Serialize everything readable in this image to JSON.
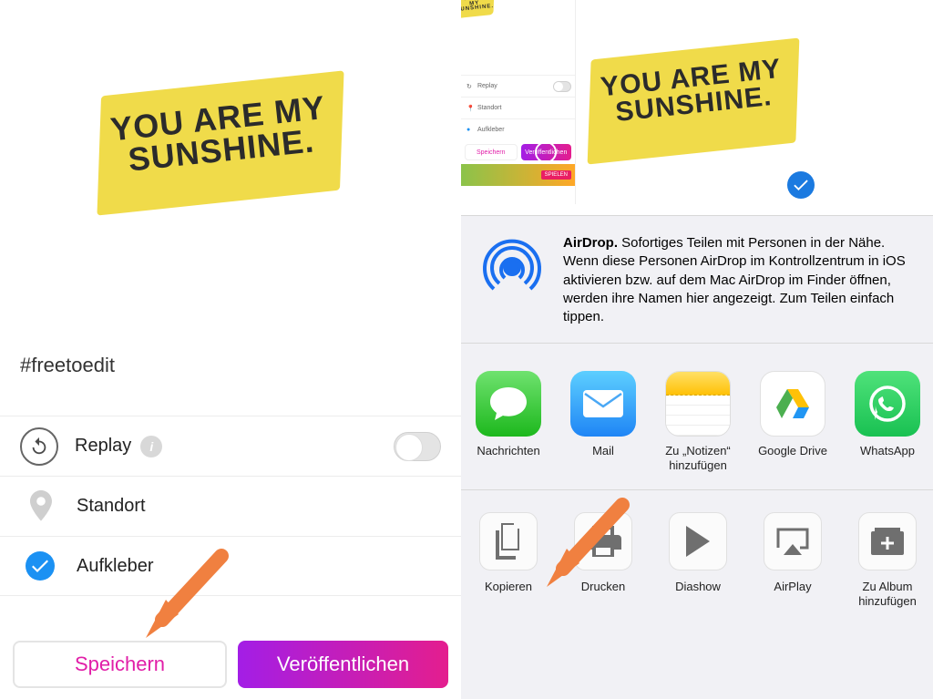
{
  "sunshine": {
    "line1": "YOU ARE MY",
    "line2": "SUNSHINE."
  },
  "left": {
    "hashtag": "#freetoedit",
    "rows": {
      "replay": "Replay",
      "location": "Standort",
      "sticker": "Aufkleber"
    },
    "buttons": {
      "save": "Speichern",
      "publish": "Veröffentlichen"
    }
  },
  "mini": {
    "replay": "Replay",
    "location": "Standort",
    "sticker": "Aufkleber",
    "save": "Speichern",
    "publish": "Veröffentlichen",
    "spielen": "SPIELEN"
  },
  "share": {
    "airdrop_bold": "AirDrop.",
    "airdrop_text": " Sofortiges Teilen mit Personen in der Nähe. Wenn diese Personen AirDrop im Kontrollzentrum in iOS aktivieren bzw. auf dem Mac AirDrop im Finder öffnen, werden ihre Namen hier angezeigt. Zum Teilen einfach tippen.",
    "apps": {
      "messages": "Nachrichten",
      "mail": "Mail",
      "notes": "Zu „Notizen“ hinzufügen",
      "drive": "Google Drive",
      "whatsapp": "WhatsApp"
    },
    "actions": {
      "copy": "Kopieren",
      "print": "Drucken",
      "slideshow": "Diashow",
      "airplay": "AirPlay",
      "album": "Zu Album hinzufügen"
    }
  }
}
